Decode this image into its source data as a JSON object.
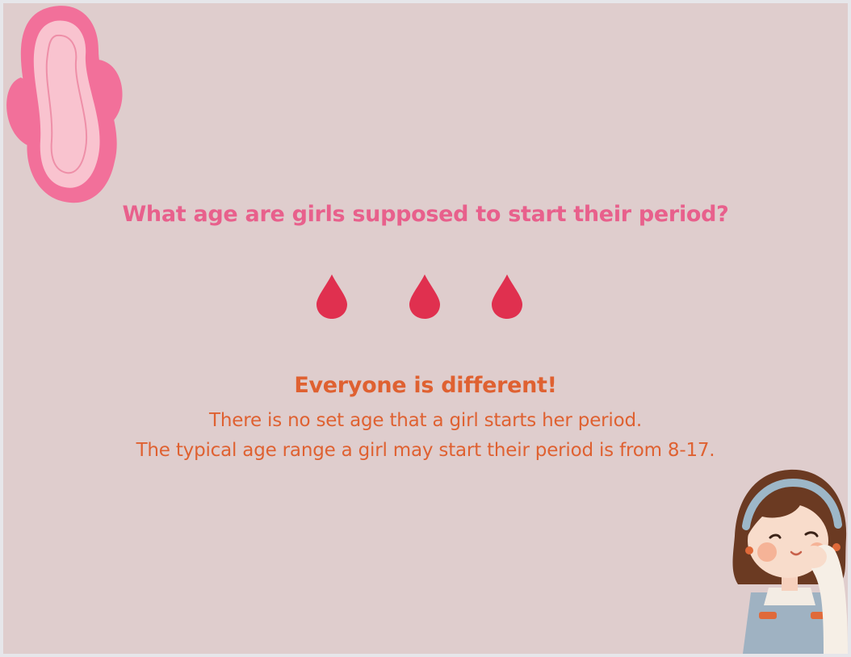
{
  "slide": {
    "question": "What age are girls supposed to start their period?",
    "answer_heading": "Everyone is different!",
    "answer_lines": [
      "There is no set age that a girl starts her period.",
      "The typical age range a girl may start their period is from 8-17."
    ]
  },
  "icons": {
    "top_left": "sanitary-pad-icon",
    "middle": [
      "blood-drop-icon",
      "blood-drop-icon",
      "blood-drop-icon"
    ],
    "bottom_right": "girl-character-illustration"
  },
  "colors": {
    "background": "#dfcdcd",
    "question_text": "#e8608c",
    "answer_text": "#df6131",
    "drop": "#e0304f",
    "pad_outer": "#f2709a",
    "pad_inner": "#f9c3cf"
  }
}
